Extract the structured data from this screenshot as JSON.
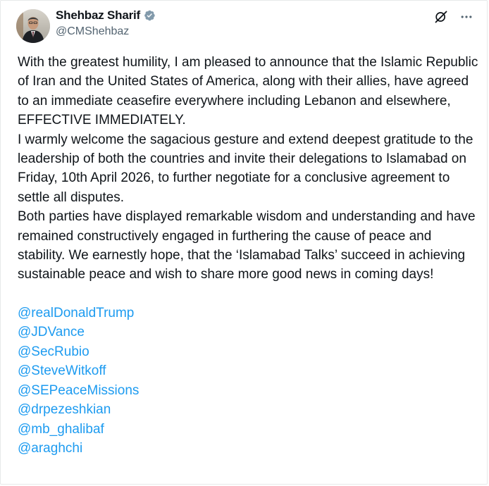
{
  "author": {
    "display_name": "Shehbaz Sharif",
    "handle": "@CMShehbaz",
    "verified": true
  },
  "header_icons": [
    "grok-icon",
    "more-icon"
  ],
  "post": {
    "paragraphs": [
      "With the greatest humility, I am pleased to announce that the Islamic Republic of Iran and the United States of America, along with their allies, have agreed to an immediate ceasefire everywhere including Lebanon and elsewhere, EFFECTIVE IMMEDIATELY.",
      "I warmly welcome the sagacious gesture and extend deepest gratitude to the leadership of both the countries and invite their delegations to Islamabad on Friday, 10th April 2026, to further negotiate for a conclusive agreement to settle all disputes.",
      "Both parties have displayed remarkable wisdom and understanding and have remained constructively engaged in furthering the cause of peace and stability. We earnestly hope, that the ‘Islamabad Talks’ succeed in achieving sustainable peace and wish to share more good news in coming days!"
    ],
    "mentions": [
      "@realDonaldTrump",
      "@JDVance",
      "@SecRubio",
      "@SteveWitkoff",
      "@SEPeaceMissions",
      "@drpezeshkian",
      "@mb_ghalibaf",
      "@araghchi"
    ]
  },
  "colors": {
    "text": "#0f1419",
    "secondary": "#536471",
    "link": "#1d9bf0",
    "verified_badge": "#829aab"
  }
}
